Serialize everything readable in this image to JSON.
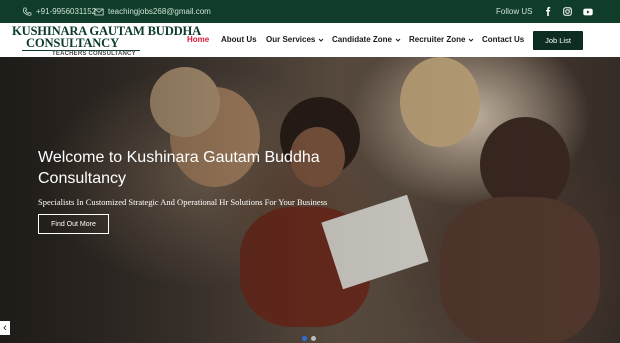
{
  "topbar": {
    "phone": "+91-9956031152",
    "email": "teachingjobs268@gmail.com",
    "follow_label": "Follow US",
    "socials": [
      "facebook-icon",
      "instagram-icon",
      "youtube-icon"
    ]
  },
  "brand": {
    "line1": "KUSHINARA GAUTAM BUDDHA",
    "line2": "CONSULTANCY",
    "tagline": "TEACHERS CONSULTANCY"
  },
  "nav": {
    "items": [
      {
        "label": "Home",
        "active": true
      },
      {
        "label": "About Us"
      },
      {
        "label": "Our Services",
        "dropdown": true
      },
      {
        "label": "Candidate Zone",
        "dropdown": true
      },
      {
        "label": "Recruiter Zone",
        "dropdown": true
      },
      {
        "label": "Contact Us"
      }
    ],
    "cta": "Job List"
  },
  "hero": {
    "title": "Welcome to Kushinara Gautam Buddha Consultancy",
    "subtitle": "Specialists In Customized Strategic And Operational Hr Solutions For Your Business",
    "button": "Find Out More",
    "prev_glyph": "‹",
    "slide_count": 2,
    "active_slide": 1
  },
  "colors": {
    "topbar_bg": "#0f3d29",
    "accent_active": "#d81b3c",
    "cta_bg": "#0d2d22",
    "dot_active": "#2a6fd6"
  }
}
